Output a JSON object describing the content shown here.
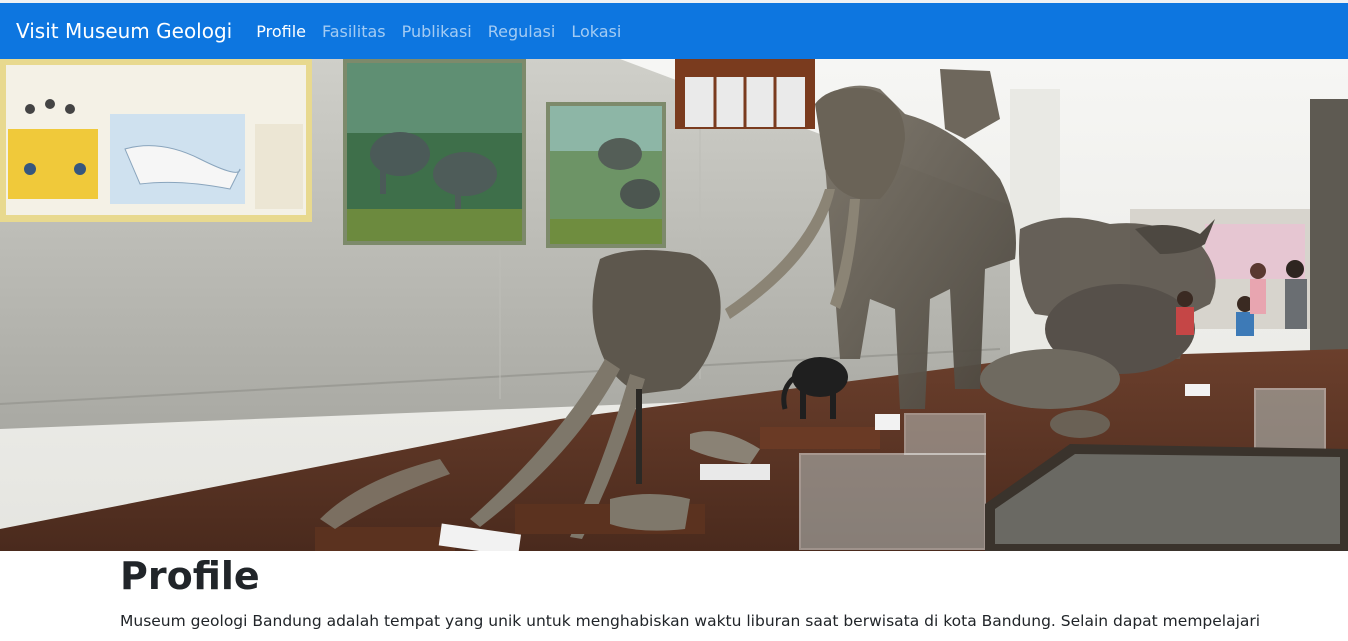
{
  "navbar": {
    "brand": "Visit Museum Geologi",
    "links": [
      {
        "label": "Profile",
        "active": true
      },
      {
        "label": "Fasilitas",
        "active": false
      },
      {
        "label": "Publikasi",
        "active": false
      },
      {
        "label": "Regulasi",
        "active": false
      },
      {
        "label": "Lokasi",
        "active": false
      }
    ],
    "bg_color": "#0d76e0"
  },
  "hero": {
    "image_subject": "museum-hall-with-elephant-skeletons"
  },
  "main": {
    "title": "Profile",
    "paragraph": "Museum geologi Bandung adalah tempat yang unik untuk menghabiskan waktu liburan saat berwisata di kota Bandung. Selain dapat mempelajari"
  }
}
